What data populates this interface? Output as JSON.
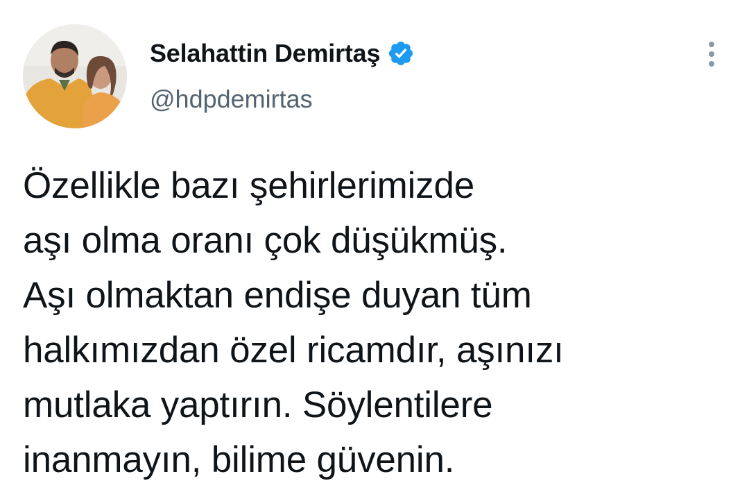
{
  "author": {
    "display_name": "Selahattin Demirtaş",
    "handle": "@hdpdemirtas",
    "verified": true,
    "avatar_icon": "profile-photo"
  },
  "tweet": {
    "text": "Özellikle bazı şehirlerimizde\naşı olma oranı çok düşükmüş.\nAşı olmaktan endişe duyan tüm\nhalkımızdan özel ricamdır, aşınızı\nmutlaka yaptırın. Söylentilere\ninanmayın, bilime güvenin."
  },
  "icons": {
    "verified": "verified-badge-icon",
    "more": "more-options-icon"
  },
  "colors": {
    "verified_blue": "#1d9bf0",
    "secondary_text": "#536471",
    "primary_text": "#0f1419",
    "background": "#ffffff"
  }
}
